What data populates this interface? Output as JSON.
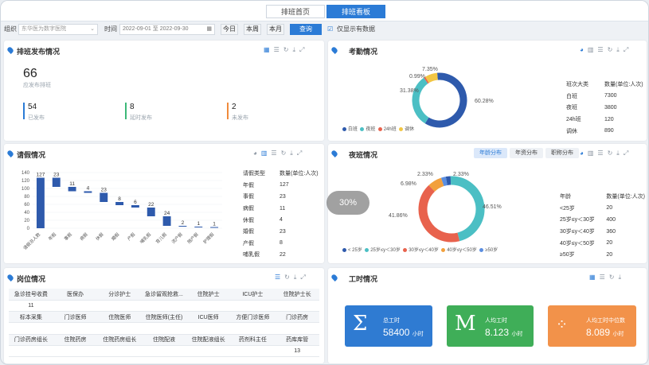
{
  "tabs": [
    {
      "label": "排班首页"
    },
    {
      "label": "排班看板"
    }
  ],
  "filter": {
    "org_label": "组织",
    "org_value": "东华医为数字医院",
    "time_label": "时间",
    "date_start": "2022-09-01",
    "date_sep": "至",
    "date_end": "2022-09-30",
    "today": "今日",
    "week": "本周",
    "month": "本月",
    "query": "查询",
    "only_data": "仅显示有数据"
  },
  "publish": {
    "title": "排班发布情况",
    "total": "66",
    "total_label": "应发布排班",
    "published": "54",
    "published_label": "已发布",
    "ontime": "8",
    "ontime_label": "延时发布",
    "unpublished": "2",
    "unpublished_label": "未发布"
  },
  "attendance": {
    "title": "考勤情况",
    "pct_labels": [
      "7.35%",
      "0.99%",
      "31.38%",
      "60.28%"
    ],
    "legend": [
      "白班",
      "夜班",
      "24h班",
      "调休"
    ],
    "table_headers": [
      "班次大类",
      "数量(单位:人次)"
    ],
    "rows": [
      {
        "k": "白班",
        "v": "7300"
      },
      {
        "k": "夜班",
        "v": "3800"
      },
      {
        "k": "24h班",
        "v": "120"
      },
      {
        "k": "调休",
        "v": "890"
      }
    ],
    "colors": [
      "#2e5aac",
      "#4bbfc4",
      "#e8624d",
      "#f2c643"
    ]
  },
  "leave": {
    "title": "请假情况",
    "table_headers": [
      "请假类型",
      "数量(单位:人次)"
    ],
    "rows": [
      {
        "k": "年假",
        "v": "127"
      },
      {
        "k": "事假",
        "v": "23"
      },
      {
        "k": "病假",
        "v": "11"
      },
      {
        "k": "休假",
        "v": "4"
      },
      {
        "k": "婚假",
        "v": "23"
      },
      {
        "k": "产假",
        "v": "8"
      },
      {
        "k": "哺乳假",
        "v": "22"
      }
    ]
  },
  "night": {
    "title": "夜班情况",
    "segs": [
      "年龄分布",
      "年资分布",
      "职称分布"
    ],
    "pct_labels": [
      "2.33%",
      "2.33%",
      "6.98%",
      "41.86%",
      "46.51%"
    ],
    "legend": [
      "< 25岁",
      "25岁≤y＜30岁",
      "30岁≤y＜40岁",
      "40岁≤y＜50岁",
      "≥50岁"
    ],
    "table_headers": [
      "年龄",
      "数量(单位:人次)"
    ],
    "rows": [
      {
        "k": "<25岁",
        "v": "20"
      },
      {
        "k": "25岁≤y＜30岁",
        "v": "400"
      },
      {
        "k": "30岁≤y＜40岁",
        "v": "360"
      },
      {
        "k": "40岁≤y＜50岁",
        "v": "20"
      },
      {
        "k": "≥50岁",
        "v": "20"
      }
    ],
    "colors": [
      "#2e5aac",
      "#4bbfc4",
      "#e8624d",
      "#f2a03d",
      "#5b8ee0"
    ]
  },
  "posts": {
    "title": "岗位情况",
    "rows": [
      [
        "急诊挂号收费",
        "医保办",
        "分诊护士",
        "急诊留观抢救...",
        "住院护士",
        "ICU护士",
        "住院护士长"
      ],
      [
        "11",
        "",
        "",
        "",
        "",
        "",
        ""
      ],
      [
        "标本采集",
        "门诊医师",
        "住院医师",
        "住院医师(主任)",
        "ICU医师",
        "方便门诊医师",
        "门诊药房"
      ],
      [
        "",
        "",
        "",
        "",
        "",
        "",
        ""
      ],
      [
        "门诊药房组长",
        "住院药房",
        "住院药房组长",
        "住院配液",
        "住院配液组长",
        "药剂科主任",
        "药库库管"
      ],
      [
        "",
        "",
        "",
        "",
        "",
        "",
        "13"
      ]
    ]
  },
  "worktime": {
    "title": "工时情况",
    "tiles": [
      {
        "label": "总工时",
        "value": "58400",
        "unit": "小时"
      },
      {
        "label": "人均工时",
        "value": "8.123",
        "unit": "小时"
      },
      {
        "label": "人均工时中位数",
        "value": "8.089",
        "unit": "小时"
      }
    ]
  },
  "overlay_label": "30%",
  "chart_data": [
    {
      "type": "bar",
      "title": "请假情况",
      "categories": [
        "请假总人数",
        "年假",
        "事假",
        "病假",
        "休假",
        "婚假",
        "产假",
        "哺乳假",
        "育儿假",
        "流产假",
        "陪产假",
        "护理假"
      ],
      "values": [
        127,
        23,
        11,
        4,
        23,
        8,
        6,
        22,
        24,
        2,
        1,
        1,
        2
      ],
      "ylim": [
        0,
        140
      ],
      "yticks": [
        0,
        20,
        40,
        60,
        80,
        100,
        120,
        140
      ]
    },
    {
      "type": "pie",
      "title": "考勤情况",
      "categories": [
        "白班",
        "夜班",
        "24h班",
        "调休"
      ],
      "values": [
        60.28,
        31.38,
        0.99,
        7.35
      ]
    },
    {
      "type": "pie",
      "title": "夜班情况",
      "categories": [
        "< 25岁",
        "25岁≤y＜30岁",
        "30岁≤y＜40岁",
        "40岁≤y＜50岁",
        "≥50岁"
      ],
      "values": [
        2.33,
        46.51,
        41.86,
        6.98,
        2.33
      ]
    }
  ]
}
